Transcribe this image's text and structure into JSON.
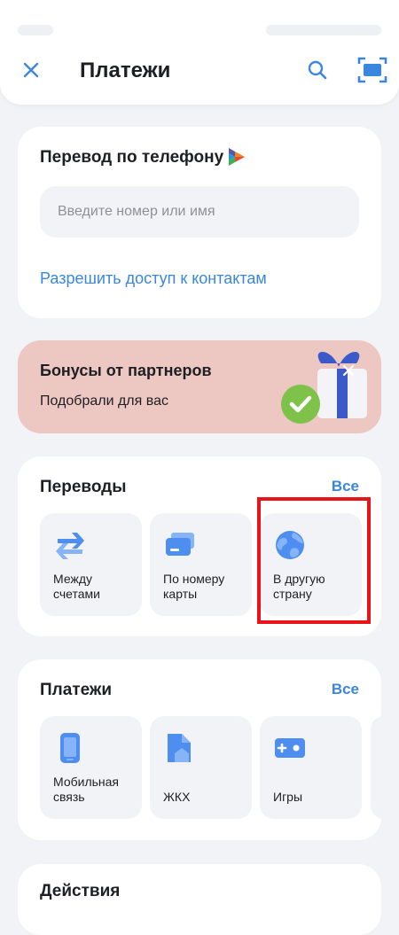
{
  "header": {
    "title": "Платежи"
  },
  "phone_transfer": {
    "title": "Перевод по телефону",
    "input_placeholder": "Введите номер или имя",
    "contacts_link": "Разрешить доступ к контактам"
  },
  "bonus": {
    "title": "Бонусы от партнеров",
    "subtitle": "Подобрали для вас"
  },
  "transfers": {
    "title": "Переводы",
    "see_all": "Все",
    "tiles": [
      {
        "label": "Между счетами",
        "icon": "arrows-exchange-icon"
      },
      {
        "label": "По номеру карты",
        "icon": "card-icon"
      },
      {
        "label": "В другую страну",
        "icon": "globe-icon"
      }
    ]
  },
  "payments": {
    "title": "Платежи",
    "see_all": "Все",
    "tiles": [
      {
        "label": "Мобильная связь",
        "icon": "mobile-phone-icon"
      },
      {
        "label": "ЖКХ",
        "icon": "house-icon"
      },
      {
        "label": "Игры",
        "icon": "gamepad-icon"
      }
    ]
  },
  "actions": {
    "title": "Действия"
  },
  "colors": {
    "accent": "#3a87e0",
    "icon_blue": "#4d8ef0",
    "banner_bg": "#edc7c1",
    "highlight": "#e8141a",
    "background": "#f2f3f6"
  }
}
